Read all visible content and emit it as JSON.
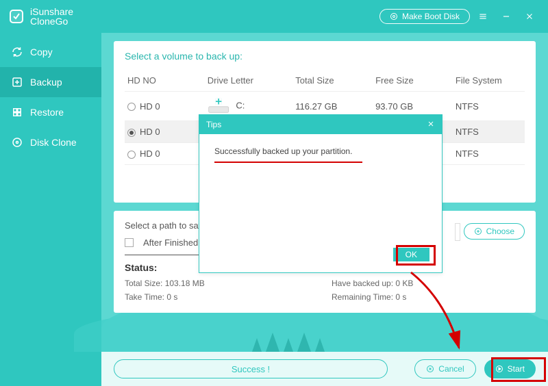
{
  "app": {
    "name_line1": "iSunshare",
    "name_line2": "CloneGo"
  },
  "titlebar": {
    "boot_label": "Make Boot Disk"
  },
  "sidebar": {
    "items": [
      {
        "label": "Copy"
      },
      {
        "label": "Backup"
      },
      {
        "label": "Restore"
      },
      {
        "label": "Disk Clone"
      }
    ]
  },
  "section1": {
    "title": "Select a volume to back up:",
    "headers": {
      "hdno": "HD NO",
      "drive": "Drive Letter",
      "total": "Total Size",
      "free": "Free Size",
      "fs": "File System"
    },
    "rows": [
      {
        "hdno": "HD 0",
        "drive": "C:",
        "total": "116.27 GB",
        "free": "93.70 GB",
        "fs": "NTFS",
        "selected": false,
        "show_icon": true
      },
      {
        "hdno": "HD 0",
        "drive": "",
        "total": "",
        "free": "",
        "fs": "NTFS",
        "selected": true,
        "show_icon": false
      },
      {
        "hdno": "HD 0",
        "drive": "",
        "total": "",
        "free": "",
        "fs": "NTFS",
        "selected": false,
        "show_icon": false
      }
    ]
  },
  "section2": {
    "path_label": "Select a path to save",
    "choose_label": "Choose",
    "after_label": "After Finished:",
    "status_title": "Status:",
    "stats": {
      "total_label": "Total Size: 103.18 MB",
      "backed_label": "Have backed up: 0 KB",
      "take_label": "Take Time: 0 s",
      "remaining_label": "Remaining Time: 0 s"
    }
  },
  "bottombar": {
    "success_label": "Success !",
    "cancel_label": "Cancel",
    "start_label": "Start"
  },
  "modal": {
    "title": "Tips",
    "message": "Successfully backed up your partition.",
    "ok_label": "OK"
  }
}
